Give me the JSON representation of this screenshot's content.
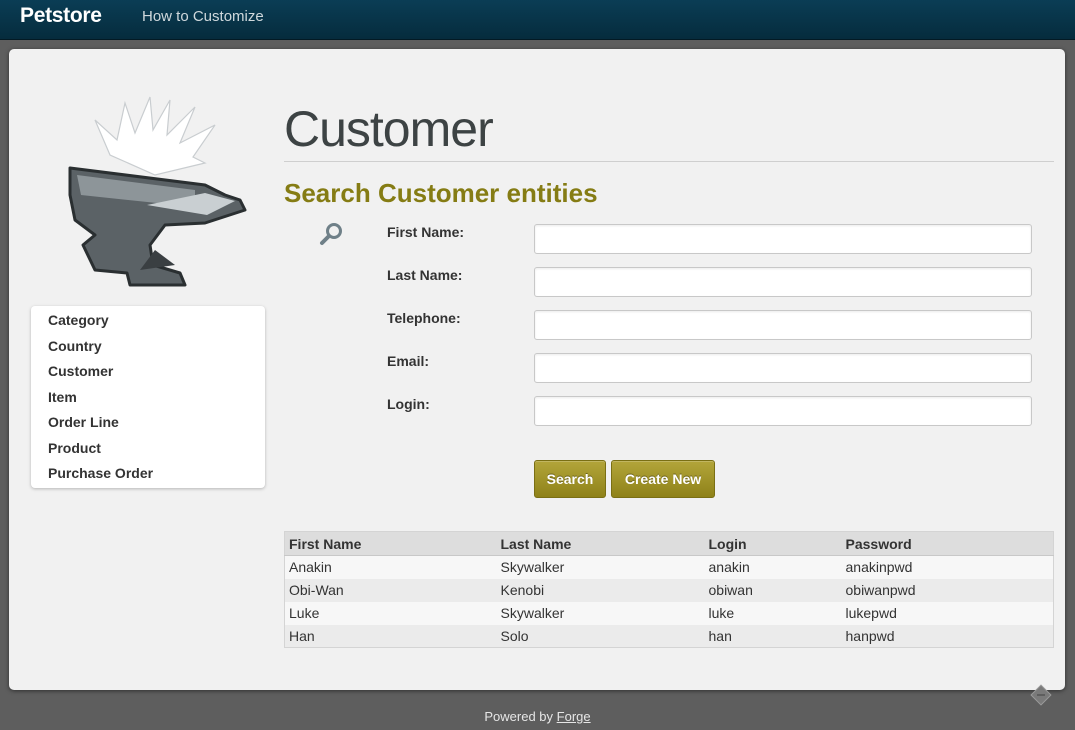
{
  "topbar": {
    "brand": "Petstore",
    "nav_link": "How to Customize"
  },
  "sidebar": {
    "items": [
      {
        "label": "Category"
      },
      {
        "label": "Country"
      },
      {
        "label": "Customer"
      },
      {
        "label": "Item"
      },
      {
        "label": "Order Line"
      },
      {
        "label": "Product"
      },
      {
        "label": "Purchase Order"
      }
    ]
  },
  "main": {
    "title": "Customer",
    "subtitle": "Search Customer entities",
    "fields": [
      {
        "label": "First Name:",
        "value": ""
      },
      {
        "label": "Last Name:",
        "value": ""
      },
      {
        "label": "Telephone:",
        "value": ""
      },
      {
        "label": "Email:",
        "value": ""
      },
      {
        "label": "Login:",
        "value": ""
      }
    ],
    "search_label": "Search",
    "create_label": "Create New"
  },
  "table": {
    "headers": [
      "First Name",
      "Last Name",
      "Login",
      "Password"
    ],
    "rows": [
      [
        "Anakin",
        "Skywalker",
        "anakin",
        "anakinpwd"
      ],
      [
        "Obi-Wan",
        "Kenobi",
        "obiwan",
        "obiwanpwd"
      ],
      [
        "Luke",
        "Skywalker",
        "luke",
        "lukepwd"
      ],
      [
        "Han",
        "Solo",
        "han",
        "hanpwd"
      ]
    ]
  },
  "footer": {
    "prefix": "Powered by",
    "link": "Forge"
  },
  "icons": [
    "anvil-logo-icon",
    "search-icon",
    "forge-corner-icon"
  ],
  "colors": {
    "accent": "#857c14",
    "button": "#a0932a",
    "topbar": "#073548"
  }
}
